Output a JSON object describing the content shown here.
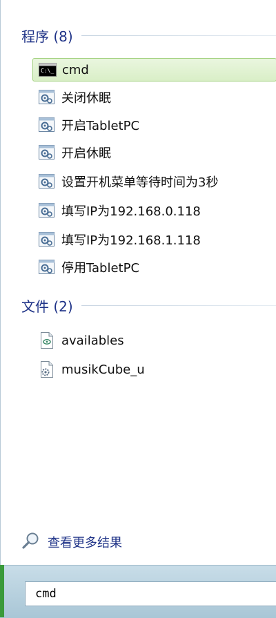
{
  "programs": {
    "header": "程序 (8)",
    "items": [
      {
        "label": "cmd",
        "icon": "cmd-icon",
        "selected": true
      },
      {
        "label": "关闭休眠",
        "icon": "script-icon"
      },
      {
        "label": "开启TabletPC",
        "icon": "script-icon"
      },
      {
        "label": "开启休眠",
        "icon": "script-icon"
      },
      {
        "label": "设置开机菜单等待时间为3秒",
        "icon": "script-icon"
      },
      {
        "label": "填写IP为192.168.0.118",
        "icon": "script-icon"
      },
      {
        "label": "填写IP为192.168.1.118",
        "icon": "script-icon"
      },
      {
        "label": "停用TabletPC",
        "icon": "script-icon"
      }
    ]
  },
  "files": {
    "header": "文件 (2)",
    "items": [
      {
        "label": "availables",
        "icon": "text-file-icon"
      },
      {
        "label": "musikCube_u",
        "icon": "settings-file-icon"
      }
    ]
  },
  "more_results": {
    "label": "查看更多结果",
    "icon": "magnifier-icon"
  },
  "search": {
    "value": "cmd"
  },
  "colors": {
    "header_text": "#1e3287",
    "selected_bg": "#d9efc7",
    "selected_border": "#9fcf7c"
  }
}
